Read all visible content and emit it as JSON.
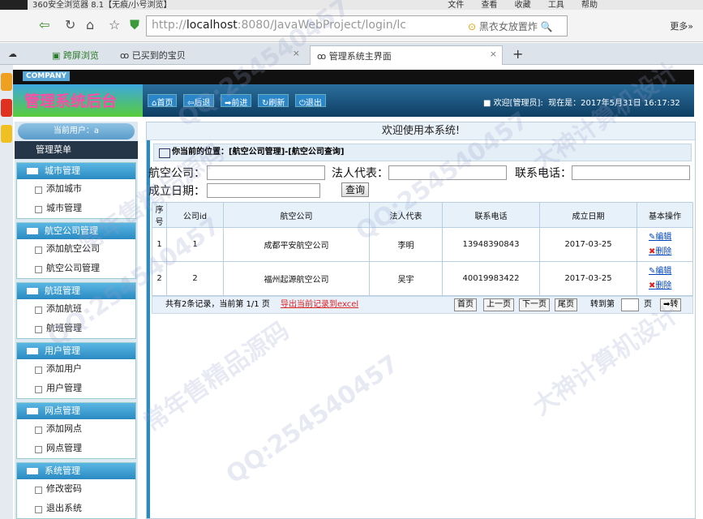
{
  "browser": {
    "title": "360安全浏览器 8.1【无痕/小号浏览】",
    "menu": [
      "文件",
      "查看",
      "收藏",
      "工具",
      "帮助"
    ],
    "url_prefix": "http://",
    "url_host": "localhost",
    "url_rest": ":8080/JavaWebProject/login/lc",
    "search_text": "黑衣女放置炸",
    "more_label": "更多»",
    "tabs": [
      "跨屏浏览",
      "已买到的宝贝",
      "管理系统主界面"
    ]
  },
  "header": {
    "company": "COMPANY",
    "brand": "管理系统后台",
    "nav": [
      "首页",
      "后退",
      "前进",
      "刷新",
      "退出"
    ],
    "welcome": "欢迎[管理员]:",
    "now": "现在是：2017年5月31日 16:17:32"
  },
  "sidebar": {
    "user": "当前用户：a",
    "menu_title": "管理菜单",
    "sections": [
      {
        "title": "城市管理",
        "items": [
          "添加城市",
          "城市管理"
        ]
      },
      {
        "title": "航空公司管理",
        "items": [
          "添加航空公司",
          "航空公司管理"
        ]
      },
      {
        "title": "航班管理",
        "items": [
          "添加航班",
          "航班管理"
        ]
      },
      {
        "title": "用户管理",
        "items": [
          "添加用户",
          "用户管理"
        ]
      },
      {
        "title": "网点管理",
        "items": [
          "添加网点",
          "网点管理"
        ]
      },
      {
        "title": "系统管理",
        "items": [
          "修改密码",
          "退出系统"
        ]
      }
    ]
  },
  "main": {
    "welcome_bar": "欢迎使用本系统!",
    "position": "你当前的位置：[航空公司管理]-[航空公司查询]",
    "labels": {
      "company": "航空公司：",
      "legal": "法人代表：",
      "phone": "联系电话：",
      "date": "成立日期："
    },
    "query_button": "查询",
    "columns": [
      "序号",
      "公司id",
      "航空公司",
      "法人代表",
      "联系电话",
      "成立日期",
      "基本操作"
    ],
    "rows": [
      {
        "no": "1",
        "id": "1",
        "name": "成都平安航空公司",
        "legal": "李明",
        "phone": "13948390843",
        "date": "2017-03-25"
      },
      {
        "no": "2",
        "id": "2",
        "name": "福州起源航空公司",
        "legal": "吴宇",
        "phone": "40019983422",
        "date": "2017-03-25"
      }
    ],
    "edit_label": "编辑",
    "delete_label": "删除",
    "pager_text": "共有2条记录，当前第 1/1 页",
    "export_label": "导出当前记录到excel",
    "pager_buttons": [
      "首页",
      "上一页",
      "下一页",
      "尾页"
    ],
    "goto_label": "转到第",
    "page_unit": "页",
    "go_button": "➡转"
  },
  "watermarks": [
    "QQ:254540457",
    "大神计算机设计",
    "常年售精品源码"
  ]
}
